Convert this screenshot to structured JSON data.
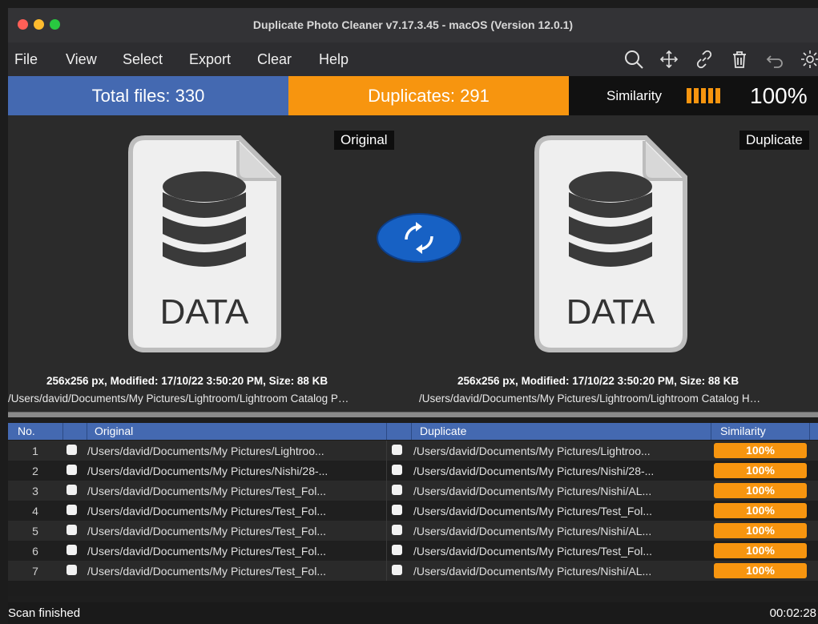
{
  "window": {
    "title": "Duplicate Photo Cleaner v7.17.3.45 - macOS (Version 12.0.1)"
  },
  "menu": [
    "File",
    "View",
    "Select",
    "Export",
    "Clear",
    "Help"
  ],
  "toolbar": {
    "icons": [
      "search-icon",
      "move-icon",
      "link-icon",
      "trash-icon",
      "undo-icon",
      "gear-icon"
    ]
  },
  "stats": {
    "total": "Total files: 330",
    "duplicates": "Duplicates: 291",
    "similarity_label": "Similarity",
    "similarity_value": "100%",
    "accent": "#f7950f",
    "blue": "#4469b1"
  },
  "preview": {
    "original_label": "Original",
    "duplicate_label": "Duplicate",
    "icon_text": "DATA",
    "original_info": "256x256 px, Modified: 17/10/22 3:50:20 PM, Size: 88 KB",
    "duplicate_info": "256x256 px, Modified: 17/10/22 3:50:20 PM, Size: 88 KB",
    "original_path": "/Users/david/Documents/My Pictures/Lightroom/Lightroom Catalog P…",
    "duplicate_path": "/Users/david/Documents/My Pictures/Lightroom/Lightroom Catalog H…"
  },
  "table": {
    "headers": {
      "no": "No.",
      "original": "Original",
      "duplicate": "Duplicate",
      "similarity": "Similarity"
    },
    "rows": [
      {
        "no": "1",
        "original": "/Users/david/Documents/My Pictures/Lightroo...",
        "duplicate": "/Users/david/Documents/My Pictures/Lightroo...",
        "similarity": "100%"
      },
      {
        "no": "2",
        "original": "/Users/david/Documents/My Pictures/Nishi/28-...",
        "duplicate": "/Users/david/Documents/My Pictures/Nishi/28-...",
        "similarity": "100%"
      },
      {
        "no": "3",
        "original": "/Users/david/Documents/My Pictures/Test_Fol...",
        "duplicate": "/Users/david/Documents/My Pictures/Nishi/AL...",
        "similarity": "100%"
      },
      {
        "no": "4",
        "original": "/Users/david/Documents/My Pictures/Test_Fol...",
        "duplicate": "/Users/david/Documents/My Pictures/Test_Fol...",
        "similarity": "100%"
      },
      {
        "no": "5",
        "original": "/Users/david/Documents/My Pictures/Test_Fol...",
        "duplicate": "/Users/david/Documents/My Pictures/Nishi/AL...",
        "similarity": "100%"
      },
      {
        "no": "6",
        "original": "/Users/david/Documents/My Pictures/Test_Fol...",
        "duplicate": "/Users/david/Documents/My Pictures/Test_Fol...",
        "similarity": "100%"
      },
      {
        "no": "7",
        "original": "/Users/david/Documents/My Pictures/Test_Fol...",
        "duplicate": "/Users/david/Documents/My Pictures/Nishi/AL...",
        "similarity": "100%"
      }
    ]
  },
  "status": {
    "text": "Scan finished",
    "time": "00:02:28"
  }
}
